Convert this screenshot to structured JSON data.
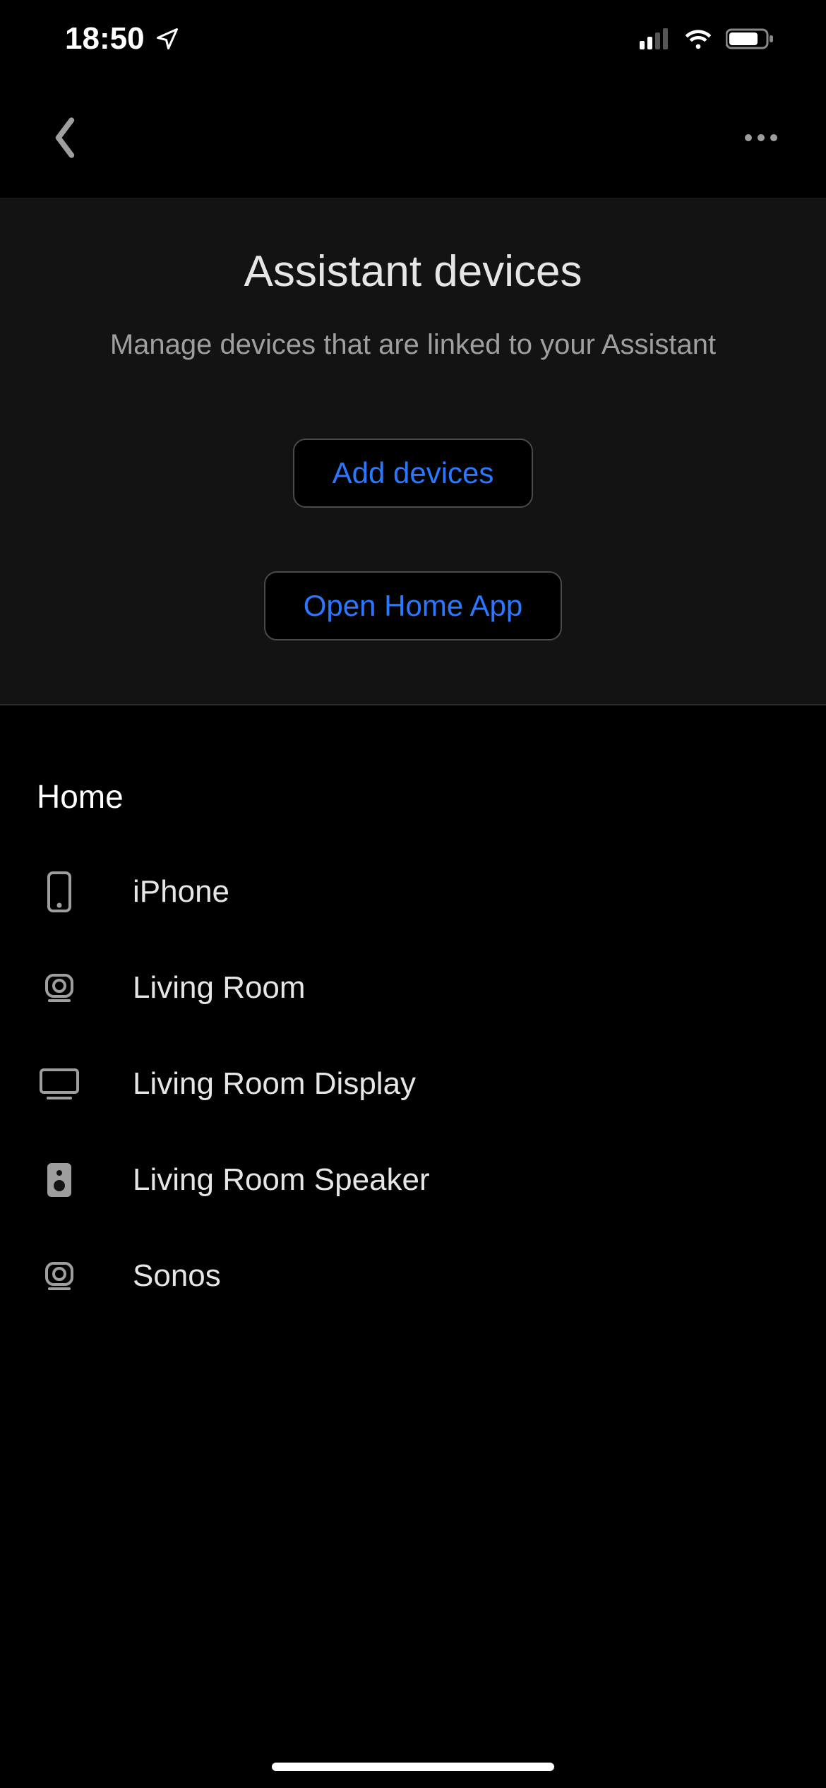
{
  "statusbar": {
    "time": "18:50"
  },
  "appbar": {
    "back_label": "back",
    "more_label": "more"
  },
  "hero": {
    "title": "Assistant devices",
    "subtitle": "Manage devices that are linked to your Assistant",
    "add_button": "Add devices",
    "open_home_button": "Open Home App"
  },
  "sections": [
    {
      "name": "Home",
      "items": [
        {
          "icon": "phone-icon",
          "label": "iPhone"
        },
        {
          "icon": "webcam-icon",
          "label": "Living Room"
        },
        {
          "icon": "tv-icon",
          "label": "Living Room Display"
        },
        {
          "icon": "speaker-icon",
          "label": "Living Room Speaker"
        },
        {
          "icon": "webcam-icon",
          "label": "Sonos"
        }
      ]
    }
  ]
}
